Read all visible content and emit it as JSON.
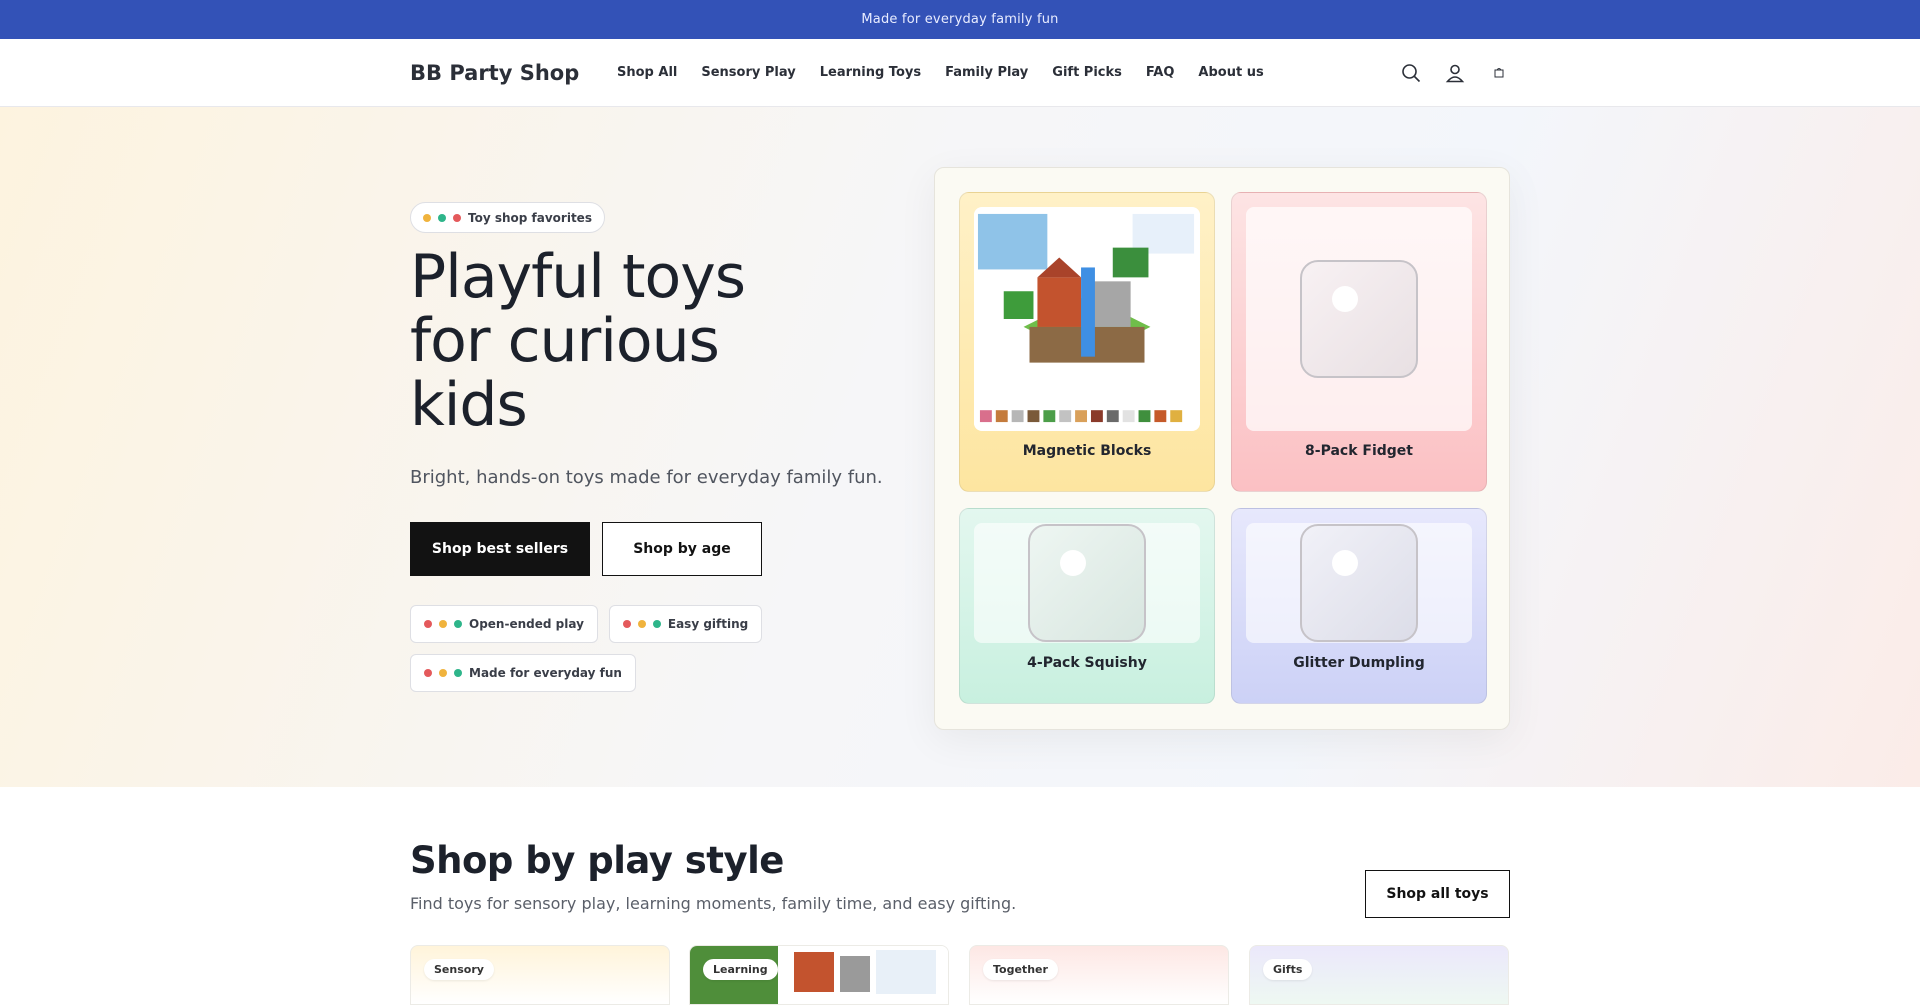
{
  "announcement": "Made for everyday family fun",
  "header": {
    "logo": "BB Party Shop",
    "nav": [
      "Shop All",
      "Sensory Play",
      "Learning Toys",
      "Family Play",
      "Gift Picks",
      "FAQ",
      "About us"
    ],
    "icons": [
      "search-icon",
      "account-icon",
      "cart-icon"
    ]
  },
  "hero": {
    "badge": "Toy shop favorites",
    "title": "Playful toys for curious kids",
    "subtitle": "Bright, hands-on toys made for everyday family fun.",
    "primary_button": "Shop best sellers",
    "secondary_button": "Shop by age",
    "features": [
      "Open-ended play",
      "Easy gifting",
      "Made for everyday fun"
    ]
  },
  "products": [
    {
      "name": "Magnetic Blocks"
    },
    {
      "name": "8-Pack Fidget"
    },
    {
      "name": "4-Pack Squishy"
    },
    {
      "name": "Glitter Dumpling"
    }
  ],
  "play_style": {
    "title": "Shop by play style",
    "subtitle": "Find toys for sensory play, learning moments, family time, and easy gifting.",
    "button": "Shop all toys",
    "categories": [
      "Sensory",
      "Learning",
      "Together",
      "Gifts"
    ]
  },
  "colors": {
    "announcement_bg": "#3352b7",
    "button_dark": "#121212"
  }
}
